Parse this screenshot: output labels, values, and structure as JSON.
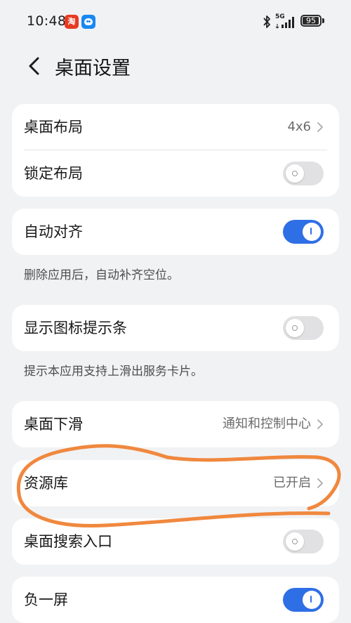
{
  "status_bar": {
    "time": "10:48",
    "taobao_badge": "淘",
    "network": "5G",
    "battery": "95",
    "battery_fill_percent": 95
  },
  "header": {
    "title": "桌面设置"
  },
  "settings": {
    "layout": {
      "label": "桌面布局",
      "value": "4x6"
    },
    "lock_layout": {
      "label": "锁定布局",
      "enabled": false
    },
    "auto_align": {
      "label": "自动对齐",
      "enabled": true,
      "hint": "删除应用后，自动补齐空位。"
    },
    "icon_hint_bar": {
      "label": "显示图标提示条",
      "enabled": false,
      "hint": "提示本应用支持上滑出服务卡片。"
    },
    "swipe_down": {
      "label": "桌面下滑",
      "value": "通知和控制中心"
    },
    "app_library": {
      "label": "资源库",
      "value": "已开启"
    },
    "search_entry": {
      "label": "桌面搜索入口",
      "enabled": false
    },
    "minus_one_screen": {
      "label": "负一屏",
      "enabled": true
    }
  },
  "colors": {
    "accent": "#2f6fe5",
    "annotation": "#f0883e",
    "background": "#f1f2f4"
  },
  "icons": [
    "back-arrow-icon",
    "chevron-right-icon",
    "bluetooth-icon",
    "signal-icon",
    "battery-icon"
  ]
}
